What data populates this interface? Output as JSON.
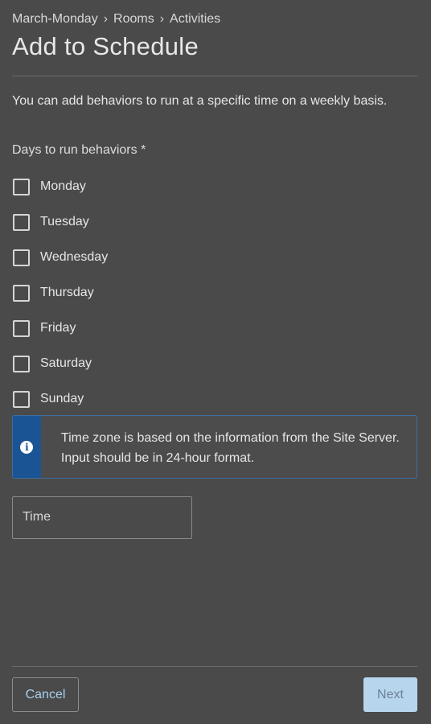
{
  "breadcrumb": {
    "items": [
      "March-Monday",
      "Rooms",
      "Activities"
    ],
    "separator": "›"
  },
  "page_title": "Add to Schedule",
  "description": "You can add behaviors to run at a specific time on a weekly basis.",
  "days": {
    "label": "Days to run behaviors *",
    "options": [
      {
        "label": "Monday",
        "checked": false
      },
      {
        "label": "Tuesday",
        "checked": false
      },
      {
        "label": "Wednesday",
        "checked": false
      },
      {
        "label": "Thursday",
        "checked": false
      },
      {
        "label": "Friday",
        "checked": false
      },
      {
        "label": "Saturday",
        "checked": false
      },
      {
        "label": "Sunday",
        "checked": false
      }
    ]
  },
  "info_banner": {
    "icon": "info-icon",
    "text": "Time zone is based on the information from the Site Server. Input should be in 24-hour format."
  },
  "time_field": {
    "label": "Time",
    "value": ""
  },
  "footer": {
    "cancel_label": "Cancel",
    "next_label": "Next"
  },
  "colors": {
    "background": "#4a4a4a",
    "info_accent": "#1b5494",
    "link": "#a8d0f0",
    "primary_disabled": "#b7d6ee"
  }
}
